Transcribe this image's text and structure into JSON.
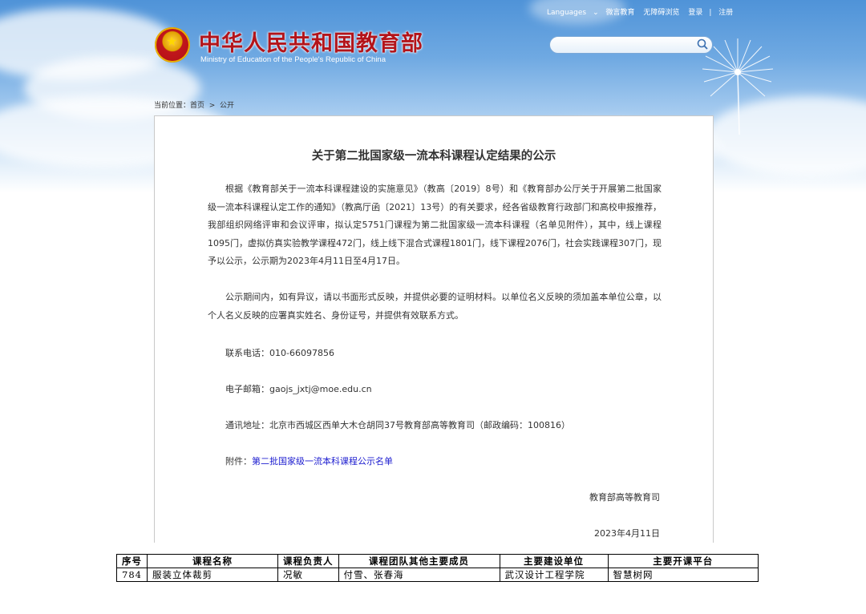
{
  "header": {
    "top_links": [
      "Languages",
      "微言教育",
      "无障碍浏览",
      "登录",
      "注册"
    ],
    "site_title": "中华人民共和国教育部",
    "site_subtitle": "Ministry of Education of the People's Republic of China",
    "search": {
      "placeholder": "",
      "value": ""
    }
  },
  "breadcrumb": {
    "prefix": "当前位置：",
    "home": "首页",
    "separator": ">",
    "current": "公开"
  },
  "article": {
    "title": "关于第二批国家级一流本科课程认定结果的公示",
    "paragraph1": "根据《教育部关于一流本科课程建设的实施意见》（教高〔2019〕8号）和《教育部办公厅关于开展第二批国家级一流本科课程认定工作的通知》（教高厅函〔2021〕13号）的有关要求，经各省级教育行政部门和高校申报推荐，我部组织网络评审和会议评审，拟认定5751门课程为第二批国家级一流本科课程（名单见附件），其中，线上课程1095门，虚拟仿真实验教学课程472门，线上线下混合式课程1801门，线下课程2076门，社会实践课程307门，现予以公示，公示期为2023年4月11日至4月17日。",
    "paragraph2": "公示期间内，如有异议，请以书面形式反映，并提供必要的证明材料。以单位名义反映的须加盖本单位公章，以个人名义反映的应署真实姓名、身份证号，并提供有效联系方式。",
    "phone": "联系电话：010-66097856",
    "email": "电子邮箱：gaojs_jxtj@moe.edu.cn",
    "address": "通讯地址：北京市西城区西单大木仓胡同37号教育部高等教育司（邮政编码：100816）",
    "attachment_label": "附件：",
    "attachment_link": "第二批国家级一流本科课程公示名单",
    "signer": "教育部高等教育司",
    "date": "2023年4月11日"
  },
  "course_table": {
    "headers": [
      "序号",
      "课程名称",
      "课程负责人",
      "课程团队其他主要成员",
      "主要建设单位",
      "主要开课平台"
    ],
    "rows": [
      [
        "784",
        "服装立体裁剪",
        "况敏",
        "付雪、张春海",
        "武汉设计工程学院",
        "智慧树网"
      ]
    ]
  },
  "colors": {
    "title_red": "#b3141a",
    "link_blue": "#2020d0",
    "sky_blue": "#4f93d8"
  }
}
